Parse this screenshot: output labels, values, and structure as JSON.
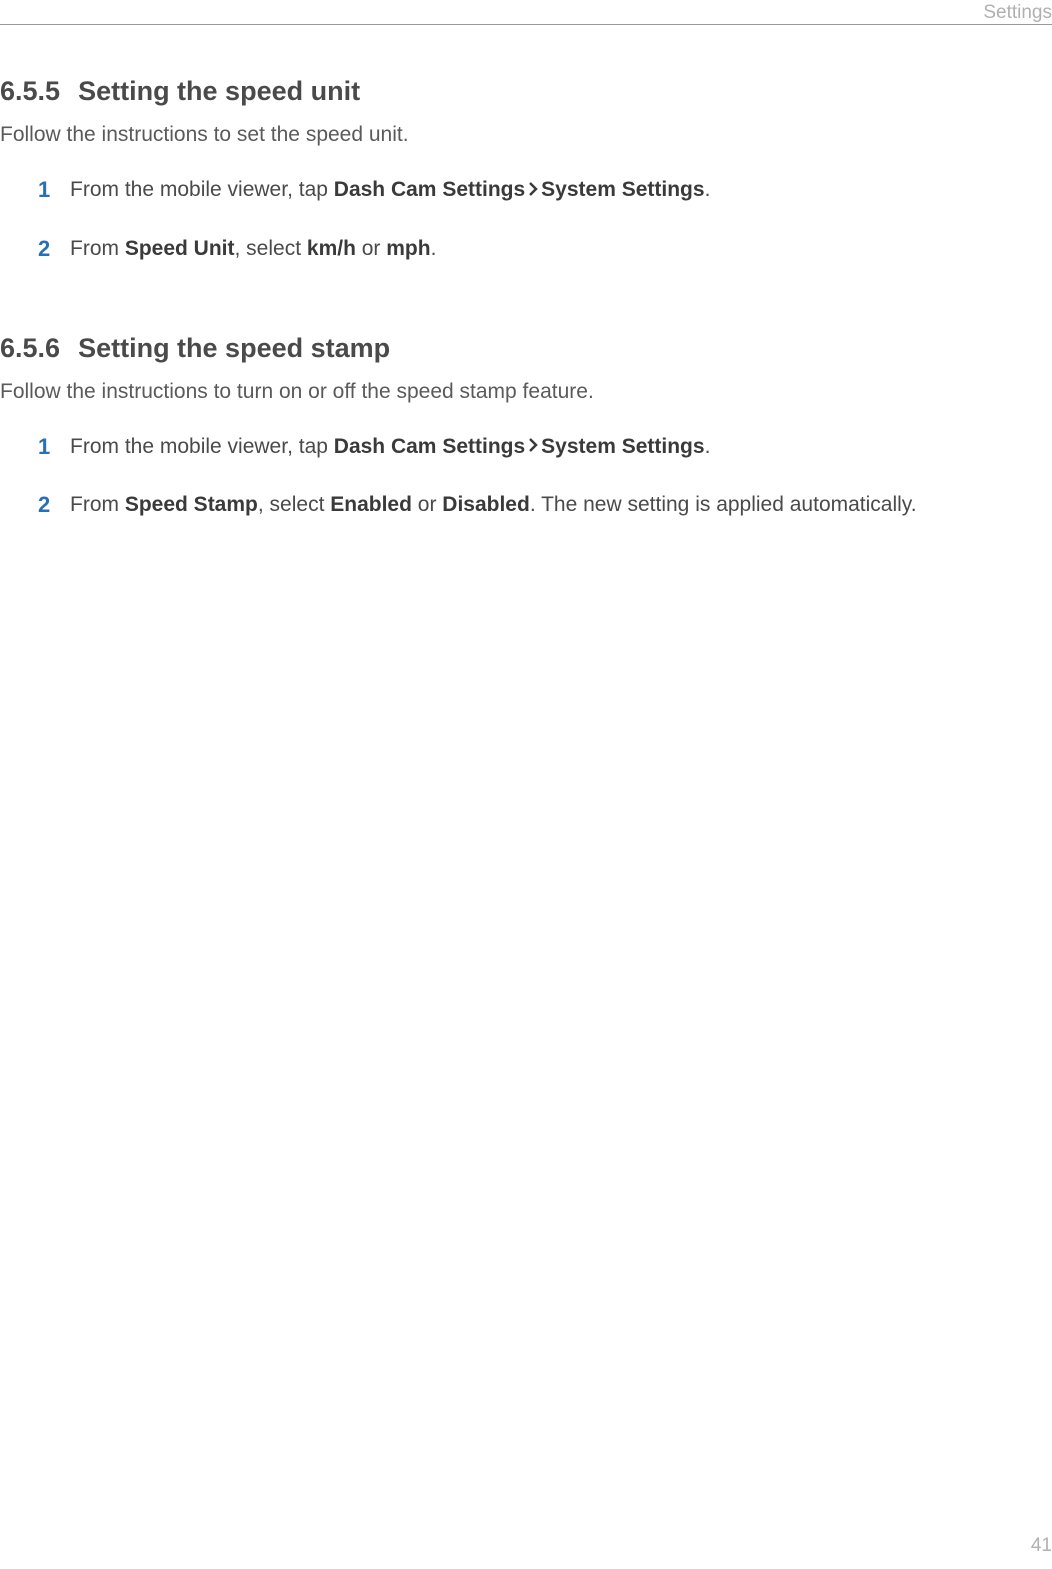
{
  "header": {
    "label": "Settings"
  },
  "sections": [
    {
      "num": "6.5.5",
      "title": "Setting the speed unit",
      "intro": "Follow the instructions to set the speed unit.",
      "steps": [
        {
          "pre": "From the mobile viewer, tap ",
          "b1": "Dash Cam Settings",
          "b2": "System Settings",
          "post": "."
        },
        {
          "pre": "From ",
          "b1": "Speed Unit",
          "mid1": ", select ",
          "b2": "km/h",
          "mid2": " or ",
          "b3": "mph",
          "post": "."
        }
      ]
    },
    {
      "num": "6.5.6",
      "title": "Setting the speed stamp",
      "intro": "Follow the instructions to turn on or off the speed stamp feature.",
      "steps": [
        {
          "pre": "From the mobile viewer, tap ",
          "b1": "Dash Cam Settings",
          "b2": "System Settings",
          "post": "."
        },
        {
          "pre": "From ",
          "b1": "Speed Stamp",
          "mid1": ", select ",
          "b2": "Enabled",
          "mid2": " or ",
          "b3": "Disabled",
          "post": ". The new setting is applied automatically."
        }
      ]
    }
  ],
  "pagenum": "41"
}
